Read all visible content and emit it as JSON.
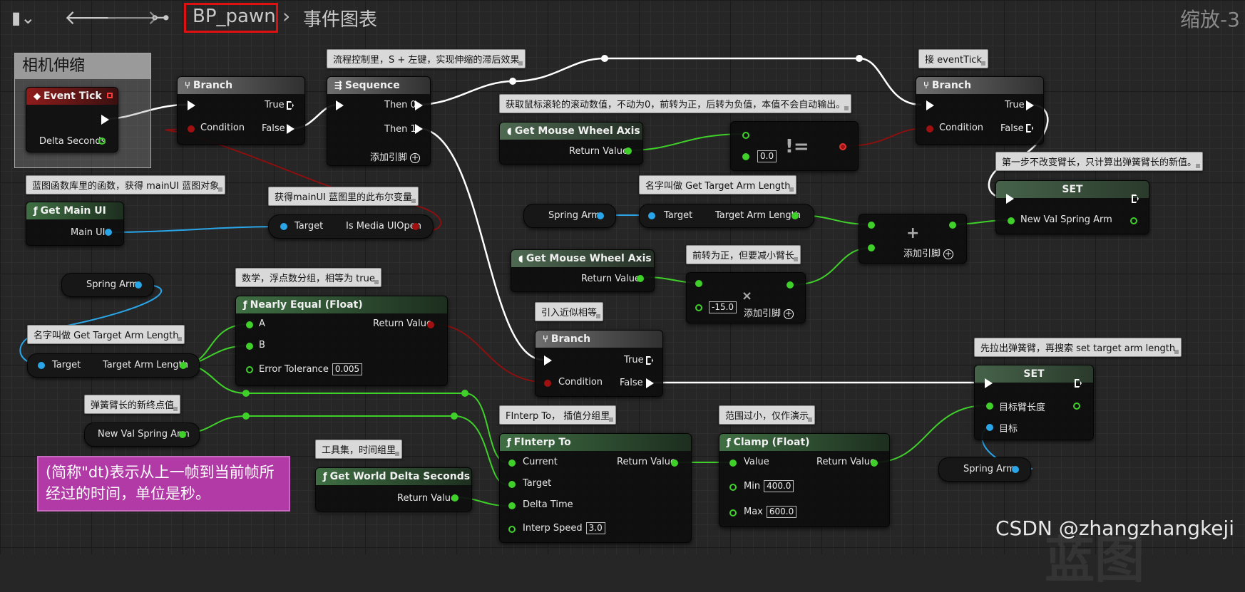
{
  "topbar": {
    "breadcrumb_blueprint": "BP_pawn",
    "breadcrumb_graph": "事件图表",
    "zoom": "缩放-3"
  },
  "group": {
    "title": "相机伸缩"
  },
  "note": {
    "text": "(简称\"dt)表示从上一帧到当前帧所经过的时间，单位是秒。"
  },
  "watermark": "CSDN @zhangzhangkeji",
  "comments": {
    "c1": "流程控制里，S + 左键，实现伸缩的滞后效果",
    "c2": "接 eventTick",
    "c3": "获取鼠标滚轮的滚动数值，不动为0，前转为正，后转为负值，本值不会自动输出。",
    "c4": "蓝图函数库里的函数，获得 mainUI 蓝图对象",
    "c5": "获得mainUI 蓝图里的此布尔变量",
    "c6": "名字叫做 Get Target Arm Length",
    "c7": "第一步不改变臂长，只计算出弹簧臂长的新值。",
    "c8": "前转为正，但要减小臂长",
    "c9": "数学，浮点数分组，相等为 true",
    "c10": "名字叫做 Get Target Arm Length",
    "c11": "引入近似相等",
    "c12": "先拉出弹簧臂，再搜索 set target arm length",
    "c13": "弹簧臂长的新终点值",
    "c14": "FInterp To， 插值分组里",
    "c15": "范围过小，仅作演示",
    "c16": "工具集，时间组里"
  },
  "nodes": {
    "event_tick": {
      "title": "Event Tick",
      "delta": "Delta Seconds"
    },
    "branch1": {
      "title": "Branch",
      "cond": "Condition",
      "t": "True",
      "f": "False"
    },
    "sequence": {
      "title": "Sequence",
      "then0": "Then 0",
      "then1": "Then 1",
      "add": "添加引脚"
    },
    "branch2": {
      "title": "Branch",
      "cond": "Condition",
      "t": "True",
      "f": "False"
    },
    "mouse1": {
      "title": "Get Mouse Wheel Axis",
      "ret": "Return Value"
    },
    "neq": {
      "op": "!=",
      "val": "0.0"
    },
    "get_main_ui": {
      "title": "Get Main UI",
      "out": "Main UI"
    },
    "is_media": {
      "target": "Target",
      "out": "Is Media UIOpen"
    },
    "spring_var1": {
      "label": "Spring Arm"
    },
    "get_arm1": {
      "target": "Target",
      "out": "Target Arm Length"
    },
    "add_node": {
      "op": "+",
      "add": "添加引脚"
    },
    "set1": {
      "title": "SET",
      "pin": "New Val Spring Arm"
    },
    "mouse2": {
      "title": "Get Mouse Wheel Axis",
      "ret": "Return Value"
    },
    "mul": {
      "op": "×",
      "val": "-15.0",
      "add": "添加引脚"
    },
    "spring_var2": {
      "label": "Spring Arm"
    },
    "nearly": {
      "title": "Nearly Equal (Float)",
      "a": "A",
      "b": "B",
      "tol": "Error Tolerance",
      "tol_val": "0.005",
      "ret": "Return Value"
    },
    "get_arm2": {
      "target": "Target",
      "out": "Target Arm Length"
    },
    "branch3": {
      "title": "Branch",
      "cond": "Condition",
      "t": "True",
      "f": "False"
    },
    "set2": {
      "title": "SET",
      "len": "目标臂长度",
      "target": "目标"
    },
    "spring_var3": {
      "label": "Spring Arm"
    },
    "newval_var": {
      "label": "New Val Spring Arm"
    },
    "finterp": {
      "title": "FInterp To",
      "current": "Current",
      "target": "Target",
      "dt": "Delta Time",
      "speed": "Interp Speed",
      "speed_val": "3.0",
      "ret": "Return Value"
    },
    "clamp": {
      "title": "Clamp (Float)",
      "value": "Value",
      "min": "Min",
      "min_val": "400.0",
      "max": "Max",
      "max_val": "600.0",
      "ret": "Return Value"
    },
    "world_dt": {
      "title": "Get World Delta Seconds",
      "ret": "Return Value"
    }
  }
}
